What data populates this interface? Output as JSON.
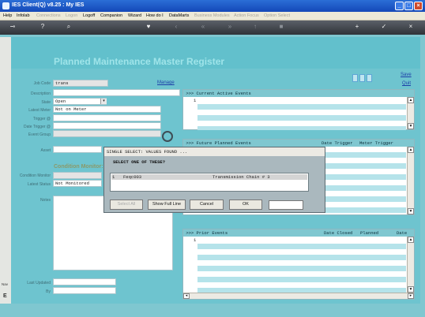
{
  "window": {
    "title": "IES Client(Q) v8.25 : My IES"
  },
  "menu": [
    {
      "label": "Help",
      "enabled": true
    },
    {
      "label": "Infolab",
      "enabled": true
    },
    {
      "label": "Connections",
      "enabled": false
    },
    {
      "label": "Logon",
      "enabled": false
    },
    {
      "label": "Logoff",
      "enabled": true
    },
    {
      "label": "Companion",
      "enabled": true
    },
    {
      "label": "Wizard",
      "enabled": true
    },
    {
      "label": "How do I",
      "enabled": true
    },
    {
      "label": "DataMarts",
      "enabled": true
    },
    {
      "label": "Business Modules",
      "enabled": false
    },
    {
      "label": "Action Focus",
      "enabled": false
    },
    {
      "label": "Option Select",
      "enabled": false
    }
  ],
  "page": {
    "title": "Planned Maintenance Master Register"
  },
  "links": {
    "manage": "Manage",
    "save": "Save",
    "quit": "Quit"
  },
  "form": {
    "job_code_label": "Job Code",
    "job_code_value": "trans",
    "description_label": "Description",
    "state_label": "State",
    "state_value": "Open",
    "latest_meter_label": "Latest Meter",
    "latest_meter_value": "Not on Meter",
    "trigger_label": "Trigger @",
    "date_trigger_label": "Date Trigger @",
    "event_group_label": "Event Group",
    "asset_label": "Asset",
    "condition_monitor_heading": "Condition Monitor:",
    "condition_monitor_label": "Condition Monitor",
    "latest_status_label": "Latest Status",
    "latest_status_value": "Not Monitored",
    "notes_label": "Notes",
    "last_updated_label": "Last Updated",
    "by_label": "By"
  },
  "current_events": {
    "header": ">>> Current Active Events",
    "marker": "1"
  },
  "future_events": {
    "header": ">>> Future Planned Events",
    "col1": "Date Trigger",
    "col2": "Meter Trigger"
  },
  "prior_events": {
    "header": ">>> Prior Events",
    "col1": "Date Closed",
    "col2": "Planned",
    "col3": "Date",
    "marker": "1"
  },
  "dialog": {
    "title": "SINGLE SELECT: VALUES FOUND ...",
    "prompt": "SELECT ONE OF THESE?",
    "rows": [
      {
        "num": "1",
        "code": "Feqc003",
        "desc": "Transmission Chain # 3"
      }
    ],
    "buttons": {
      "select_all": "Select All",
      "show_full_line": "Show Full Line",
      "cancel": "Cancel",
      "ok": "OK"
    }
  },
  "side": {
    "left_tab": "Nav",
    "left_marker": "E"
  }
}
